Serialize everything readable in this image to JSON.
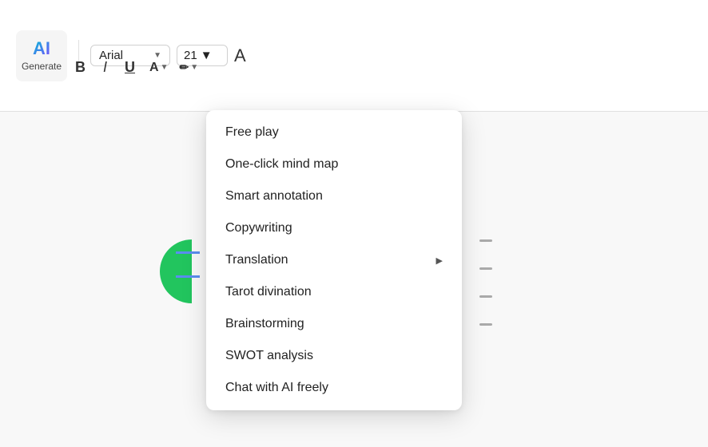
{
  "toolbar": {
    "generate_label": "Generate",
    "ai_text": "AI",
    "font_name": "Arial",
    "font_size": "21",
    "large_a": "A",
    "bold": "B",
    "italic": "I",
    "underline": "U",
    "font_color": "A",
    "highlight": "🖊"
  },
  "menu": {
    "items": [
      {
        "label": "Free play",
        "has_arrow": false
      },
      {
        "label": "One-click mind map",
        "has_arrow": false
      },
      {
        "label": "Smart annotation",
        "has_arrow": false
      },
      {
        "label": "Copywriting",
        "has_arrow": false
      },
      {
        "label": "Translation",
        "has_arrow": true
      },
      {
        "label": "Tarot divination",
        "has_arrow": false
      },
      {
        "label": "Brainstorming",
        "has_arrow": false
      },
      {
        "label": "SWOT analysis",
        "has_arrow": false
      },
      {
        "label": "Chat with AI freely",
        "has_arrow": false
      }
    ]
  }
}
